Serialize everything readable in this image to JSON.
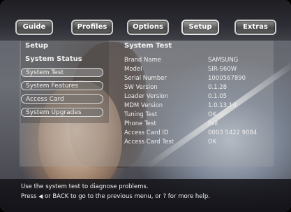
{
  "nav": {
    "tabs": [
      {
        "label": "Guide"
      },
      {
        "label": "Profiles"
      },
      {
        "label": "Options"
      },
      {
        "label": "Setup"
      },
      {
        "label": "Extras"
      }
    ],
    "active_tab": "Setup"
  },
  "left_menu": {
    "title": "Setup",
    "items": [
      {
        "label": "System Status"
      },
      {
        "label": "System Test"
      },
      {
        "label": "System Features"
      },
      {
        "label": "Access Card"
      },
      {
        "label": "System Upgrades"
      }
    ]
  },
  "detail": {
    "title": "System Test",
    "rows": [
      {
        "label": "Brand Name",
        "value": "SAMSUNG"
      },
      {
        "label": "Model",
        "value": "SIR-S60W"
      },
      {
        "label": "Serial Number",
        "value": "1000567890"
      },
      {
        "label": "SW Version",
        "value": "0.1.28"
      },
      {
        "label": "Loader Version",
        "value": "0.1.05"
      },
      {
        "label": "MDM Version",
        "value": "1.0.13.1d"
      },
      {
        "label": "Tuning Test",
        "value": "OK"
      },
      {
        "label": "Phone Test",
        "value": "Fail"
      },
      {
        "label": "Access Card ID",
        "value": "0003 5422 9084"
      },
      {
        "label": "Access Card Test",
        "value": "OK"
      }
    ]
  },
  "help": {
    "line1": "Use the system test to diagnose problems.",
    "line2_prefix": "Press",
    "line2_rest": "or BACK to go to the previous menu, or ? for more help."
  }
}
